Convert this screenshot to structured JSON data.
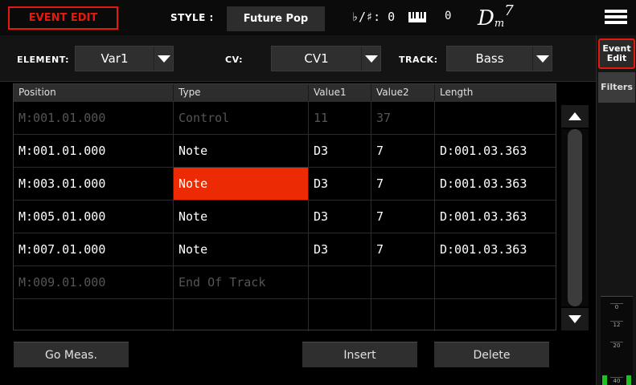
{
  "header": {
    "page_title": "EVENT EDIT",
    "style_label": "STYLE :",
    "style_name": "Future Pop",
    "transpose": "♭/♯: 0",
    "octave": "0",
    "chord_root": "D",
    "chord_quality": "m",
    "chord_ext": "7",
    "menu_icon": "hamburger-menu-icon"
  },
  "selectors": {
    "element_label": "ELEMENT:",
    "element_value": "Var1",
    "cv_label": "CV:",
    "cv_value": "CV1",
    "track_label": "TRACK:",
    "track_value": "Bass"
  },
  "table": {
    "columns": [
      "Position",
      "Type",
      "Value1",
      "Value2",
      "Length"
    ],
    "rows": [
      {
        "position": "M:001.01.000",
        "type": "Control",
        "value1": "11",
        "value2": "37",
        "length": ""
      },
      {
        "position": "M:001.01.000",
        "type": "Note",
        "value1": "D3",
        "value2": "7",
        "length": "D:001.03.363"
      },
      {
        "position": "M:003.01.000",
        "type": "Note",
        "value1": "D3",
        "value2": "7",
        "length": "D:001.03.363"
      },
      {
        "position": "M:005.01.000",
        "type": "Note",
        "value1": "D3",
        "value2": "7",
        "length": "D:001.03.363"
      },
      {
        "position": "M:007.01.000",
        "type": "Note",
        "value1": "D3",
        "value2": "7",
        "length": "D:001.03.363"
      },
      {
        "position": "M:009.01.000",
        "type": "End Of Track",
        "value1": "",
        "value2": "",
        "length": ""
      },
      {
        "position": "",
        "type": "",
        "value1": "",
        "value2": "",
        "length": ""
      }
    ],
    "selected_row": 2,
    "selected_column": "type"
  },
  "buttons": {
    "go_meas": "Go Meas.",
    "insert": "Insert",
    "delete": "Delete"
  },
  "side_tabs": {
    "event_edit": "Event Edit",
    "filters": "Filters"
  },
  "meter": {
    "marks": [
      "0",
      "12",
      "20",
      "40"
    ]
  },
  "colors": {
    "accent_red": "#e41a0c",
    "selection": "#ec2a04",
    "meter_green": "#20c020"
  }
}
